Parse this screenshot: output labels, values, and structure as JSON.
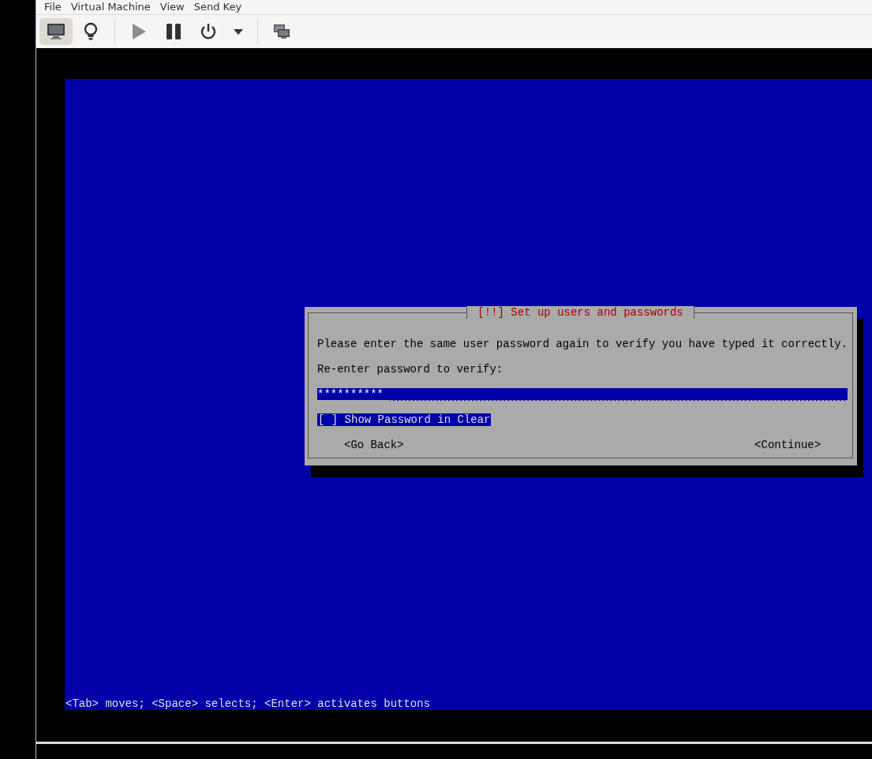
{
  "menu": [
    "File",
    "Virtual Machine",
    "View",
    "Send Key"
  ],
  "toolbar": [
    {
      "kind": "console",
      "selected": true
    },
    {
      "kind": "details",
      "selected": false
    },
    {
      "kind": "run",
      "selected": false,
      "disabled": true
    },
    {
      "kind": "pause",
      "selected": false
    },
    {
      "kind": "power",
      "selected": false
    },
    {
      "kind": "dropdown",
      "selected": false
    },
    {
      "kind": "snapshots",
      "selected": false
    }
  ],
  "dialog": {
    "title": "[!!] Set up users and passwords",
    "message": "Please enter the same user password again to verify you have typed it correctly.",
    "label": "Re-enter password to verify:",
    "password": {
      "value": "**********",
      "focused": false
    },
    "checkbox": {
      "text": "[ ] Show Password in Clear",
      "focused": true
    },
    "buttons": [
      {
        "label": "<Go Back>",
        "focused": false
      },
      {
        "label": "<Continue>",
        "focused": false
      }
    ]
  },
  "help_line": "<Tab> moves; <Space> selects; <Enter> activates buttons"
}
